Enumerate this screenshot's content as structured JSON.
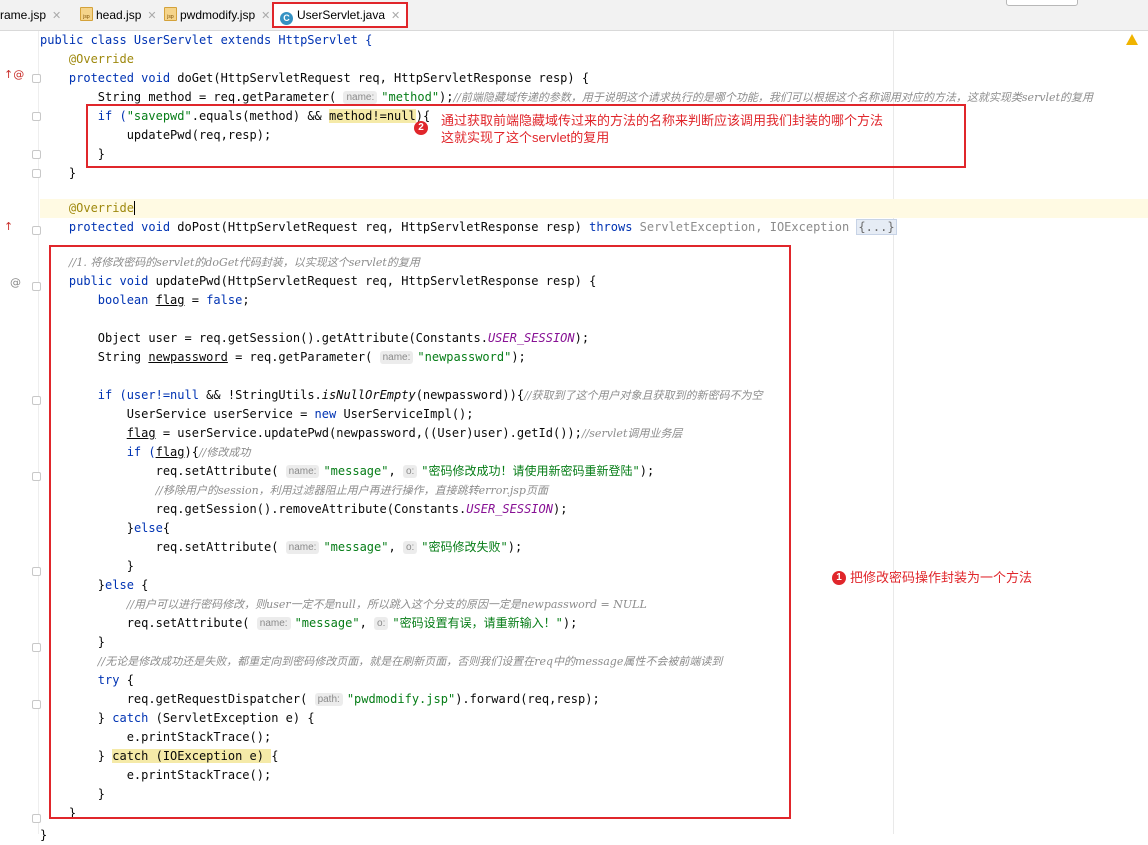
{
  "tabs": [
    {
      "label": "rame.jsp",
      "type": "jsp"
    },
    {
      "label": "head.jsp",
      "type": "jsp"
    },
    {
      "label": "pwdmodify.jsp",
      "type": "jsp"
    },
    {
      "label": "UserServlet.java",
      "type": "class",
      "active": true
    }
  ],
  "annotations": {
    "badge1": "1",
    "note1": "把修改密码操作封装为一个方法",
    "badge2": "2",
    "note2_line1": "通过获取前端隐藏域传过来的方法的名称来判断应该调用我们封装的哪个方法",
    "note2_line2": "这就实现了这个servlet的复用"
  },
  "code": {
    "l1": "public class UserServlet extends HttpServlet {",
    "l2": "@Override",
    "l3a": "protected void ",
    "l3b": "doGet(HttpServletRequest req, HttpServletResponse resp) {",
    "l4a": "String method = req.getParameter(",
    "l4hint": "name:",
    "l4str": "\"method\"",
    "l4b": ");",
    "l4cm": "//前端隐藏域传递的参数，用于说明这个请求执行的是哪个功能，我们可以根据这个名称调用对应的方法，这就实现类servlet的复用",
    "l5a": "if (",
    "l5str": "\"savepwd\"",
    "l5b": ".equals(method) && ",
    "l5c": "method!=null",
    "l5d": "){",
    "l6": "updatePwd(req,resp);",
    "l7": "}",
    "l8": "}",
    "l9": "@Override",
    "l10a": "protected void ",
    "l10b": "doPost(HttpServletRequest req, HttpServletResponse resp) ",
    "l10c": "throws ",
    "l10d": "ServletException, IOException ",
    "l10e": "{...}",
    "l11": "//1. 将修改密码的servlet的doGet代码封装，以实现这个servlet的复用",
    "l12a": "public void ",
    "l12b": "updatePwd(HttpServletRequest req, HttpServletResponse resp) {",
    "l13a": "boolean ",
    "l13b": "flag",
    "l13c": " = ",
    "l13d": "false",
    "l13e": ";",
    "l14a": "Object user = req.getSession().getAttribute(Constants.",
    "l14b": "USER_SESSION",
    "l14c": ");",
    "l15a": "String ",
    "l15b": "newpassword",
    "l15c": " = req.getParameter(",
    "l15hint": "name:",
    "l15str": "\"newpassword\"",
    "l15d": ");",
    "l16a": "if (user!=",
    "l16b": "null",
    "l16c": " && !StringUtils.",
    "l16d": "isNullOrEmpty",
    "l16e": "(newpassword)){",
    "l16cm": "//获取到了这个用户对象且获取到的新密码不为空",
    "l17a": "UserService userService = ",
    "l17b": "new ",
    "l17c": "UserServiceImpl();",
    "l18a": "flag",
    "l18b": " = userService.updatePwd(newpassword,((User)user).getId());",
    "l18cm": "//servlet调用业务层",
    "l19a": "if (",
    "l19b": "flag",
    "l19c": "){",
    "l19cm": "//修改成功",
    "l20a": "req.setAttribute(",
    "l20hint1": "name:",
    "l20str1": "\"message\"",
    "l20hint2": "o:",
    "l20str2": "\"密码修改成功！请使用新密码重新登陆\"",
    "l20b": ");",
    "l21cm": "//移除用户的session，利用过滤器阻止用户再进行操作，直接跳转error.jsp页面",
    "l22a": "req.getSession().removeAttribute(Constants.",
    "l22b": "USER_SESSION",
    "l22c": ");",
    "l23a": "}",
    "l23b": "else",
    "l23c": "{",
    "l24a": "req.setAttribute(",
    "l24hint1": "name:",
    "l24str1": "\"message\"",
    "l24hint2": "o:",
    "l24str2": "\"密码修改失败\"",
    "l24b": ");",
    "l25": "}",
    "l26a": "}",
    "l26b": "else ",
    "l26c": "{",
    "l27cm": "//用户可以进行密码修改，则user一定不是null，所以跳入这个分支的原因一定是newpassword = NULL",
    "l28a": "req.setAttribute(",
    "l28hint1": "name:",
    "l28str1": "\"message\"",
    "l28hint2": "o:",
    "l28str2": "\"密码设置有误，请重新输入！\"",
    "l28b": ");",
    "l29": "}",
    "l30cm": "//无论是修改成功还是失败，都重定向到密码修改页面，就是在刷新页面，否则我们设置在req中的message属性不会被前端读到",
    "l31a": "try ",
    "l31b": "{",
    "l32a": "req.getRequestDispatcher(",
    "l32hint": "path:",
    "l32str": "\"pwdmodify.jsp\"",
    "l32b": ").forward(req,resp);",
    "l33a": "} ",
    "l33b": "catch ",
    "l33c": "(ServletException e) {",
    "l34": "e.printStackTrace();",
    "l35a": "} ",
    "l35b": "catch (IOException e) ",
    "l35c": "{",
    "l36": "e.printStackTrace();",
    "l37": "}",
    "l38": "}",
    "l39": "}"
  },
  "colors": {
    "annotation_red": "#e0262b",
    "keyword": "#0033b3",
    "string": "#067d17",
    "comment": "#8c8c8c",
    "annotation": "#9e880d"
  }
}
